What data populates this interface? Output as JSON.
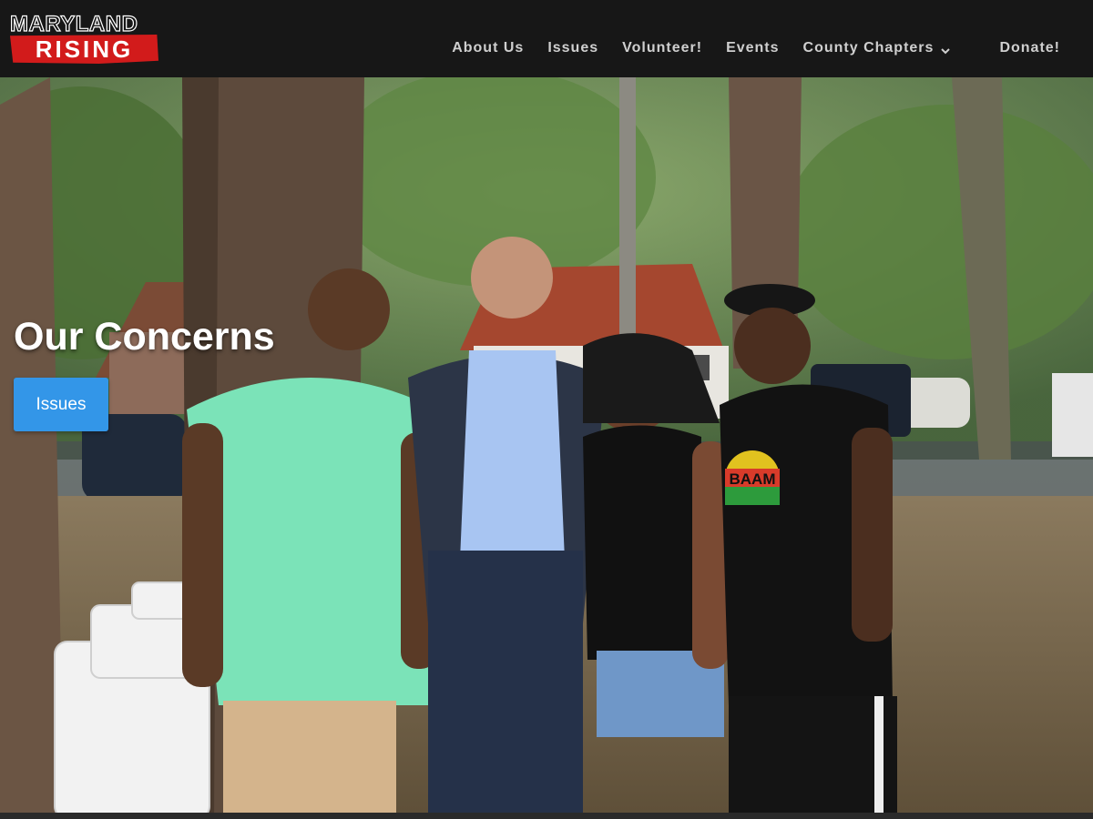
{
  "logo": {
    "line1": "Maryland",
    "line2": "Rising"
  },
  "nav": {
    "items": [
      {
        "label": "About Us",
        "icon": null
      },
      {
        "label": "Issues",
        "icon": null
      },
      {
        "label": "Volunteer!",
        "icon": null
      },
      {
        "label": "Events",
        "icon": null
      },
      {
        "label": "County Chapters",
        "icon": "chevron-down-icon"
      }
    ],
    "donate": "Donate!"
  },
  "hero": {
    "title": "Our Concerns",
    "button": "Issues",
    "image": "group-photo-four-people-under-trees",
    "t_shirt_logo_text": "BAAM"
  },
  "colors": {
    "header_bg": "#171717",
    "nav_text": "#cfcfcf",
    "logo_red": "#d21b1b",
    "button_blue": "#3396e8"
  }
}
